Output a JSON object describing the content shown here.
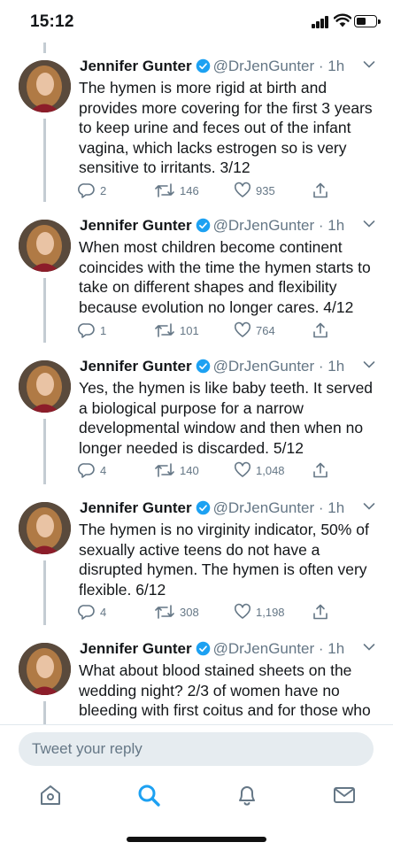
{
  "status_bar": {
    "time": "15:12",
    "battery_level": 0.48
  },
  "tweets": [
    {
      "author": "Jennifer Gunter",
      "handle": "@DrJenGunter",
      "age": "1h",
      "text": "The hymen is more rigid at birth and provides more covering for the first 3 years to keep urine and feces out of the infant vagina, which lacks estrogen so is very sensitive to irritants. 3/12",
      "replies": "2",
      "retweets": "146",
      "likes": "935"
    },
    {
      "author": "Jennifer Gunter",
      "handle": "@DrJenGunter",
      "age": "1h",
      "text": "When most children become continent coincides with the time the hymen starts to take on different shapes and flexibility because evolution no longer cares. 4/12",
      "replies": "1",
      "retweets": "101",
      "likes": "764"
    },
    {
      "author": "Jennifer Gunter",
      "handle": "@DrJenGunter",
      "age": "1h",
      "text": "Yes, the hymen is like baby teeth. It served a biological purpose for a narrow developmental window and then when no longer needed is discarded. 5/12",
      "replies": "4",
      "retweets": "140",
      "likes": "1,048"
    },
    {
      "author": "Jennifer Gunter",
      "handle": "@DrJenGunter",
      "age": "1h",
      "text": "The hymen is no virginity indicator, 50% of sexually active teens do not have a disrupted hymen. The hymen is often very flexible. 6/12",
      "replies": "4",
      "retweets": "308",
      "likes": "1,198"
    },
    {
      "author": "Jennifer Gunter",
      "handle": "@DrJenGunter",
      "age": "1h",
      "text": "What about blood stained sheets on the wedding night? 2/3 of women have no bleeding with first coitus and for those who do it is usually spotting. The hymen",
      "replies": "",
      "retweets": "",
      "likes": ""
    }
  ],
  "reply": {
    "placeholder": "Tweet your reply"
  },
  "tabs": [
    "home-icon",
    "search-icon",
    "notifications-icon",
    "messages-icon"
  ],
  "colors": {
    "accent": "#1da1f2",
    "secondary_text": "#657786",
    "thread_line": "#c4ccd3",
    "reply_bg": "#e6ecf0"
  }
}
